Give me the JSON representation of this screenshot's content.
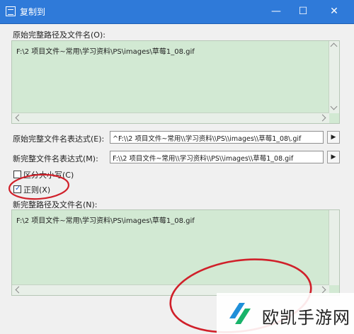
{
  "window": {
    "title": "复制到",
    "minimize_glyph": "—",
    "maximize_glyph": "☐",
    "close_glyph": "✕"
  },
  "original_path": {
    "label": "原始完整路径及文件名(O):",
    "value": "F:\\2 项目文件~常用\\学习资料\\PS\\images\\草莓1_08.gif"
  },
  "original_expr": {
    "label": "原始完整文件名表达式(E):",
    "value": "^F:\\\\2 项目文件~常用\\\\学习资料\\\\PS\\\\images\\\\草莓1_08\\.gif"
  },
  "new_expr": {
    "label": "新完整文件名表达式(M):",
    "value": "F:\\\\2 项目文件~常用\\\\学习资料\\\\PS\\\\images\\\\草莓1_08.gif"
  },
  "options": {
    "case_sensitive": {
      "label": "区分大小写(C)",
      "checked": false
    },
    "regex": {
      "label": "正则(X)",
      "checked": true
    }
  },
  "new_path": {
    "label": "新完整路径及文件名(N):",
    "value": "F:\\2 项目文件~常用\\学习资料\\PS\\images\\草莓1_08.gif"
  },
  "colors": {
    "titlebar": "#2f7ad9",
    "textarea_bg": "#d2e9d3",
    "annotation": "#d0202a"
  },
  "watermark": {
    "text": "欧凯手游网"
  }
}
